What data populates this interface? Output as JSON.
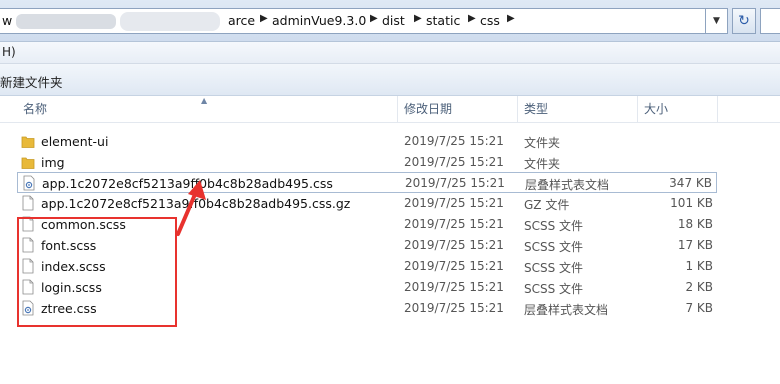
{
  "address": {
    "crumbs": [
      "arce",
      "adminVue9.3.0",
      "dist",
      "static",
      "css"
    ],
    "obscured_prefix": "w"
  },
  "menu": {
    "partial_label": "H)"
  },
  "toolbar": {
    "new_folder_label": "新建文件夹"
  },
  "columns": {
    "name": "名称",
    "modified": "修改日期",
    "type": "类型",
    "size": "大小"
  },
  "files": [
    {
      "name": "element-ui",
      "date": "2019/7/25 15:21",
      "type": "文件夹",
      "size": "",
      "icon": "folder-icon"
    },
    {
      "name": "img",
      "date": "2019/7/25 15:21",
      "type": "文件夹",
      "size": "",
      "icon": "folder-icon"
    },
    {
      "name": "app.1c2072e8cf5213a9ff0b4c8b28adb495.css",
      "date": "2019/7/25 15:21",
      "type": "层叠样式表文档",
      "size": "347 KB",
      "icon": "css-file-icon",
      "selected": true
    },
    {
      "name": "app.1c2072e8cf5213a9ff0b4c8b28adb495.css.gz",
      "date": "2019/7/25 15:21",
      "type": "GZ 文件",
      "size": "101 KB",
      "icon": "file-icon"
    },
    {
      "name": "common.scss",
      "date": "2019/7/25 15:21",
      "type": "SCSS 文件",
      "size": "18 KB",
      "icon": "file-icon"
    },
    {
      "name": "font.scss",
      "date": "2019/7/25 15:21",
      "type": "SCSS 文件",
      "size": "17 KB",
      "icon": "file-icon"
    },
    {
      "name": "index.scss",
      "date": "2019/7/25 15:21",
      "type": "SCSS 文件",
      "size": "1 KB",
      "icon": "file-icon"
    },
    {
      "name": "login.scss",
      "date": "2019/7/25 15:21",
      "type": "SCSS 文件",
      "size": "2 KB",
      "icon": "file-icon"
    },
    {
      "name": "ztree.css",
      "date": "2019/7/25 15:21",
      "type": "层叠样式表文档",
      "size": "7 KB",
      "icon": "css-file-icon"
    }
  ],
  "colors": {
    "annotation": "#e8322e",
    "folder": "#e8b93a"
  }
}
